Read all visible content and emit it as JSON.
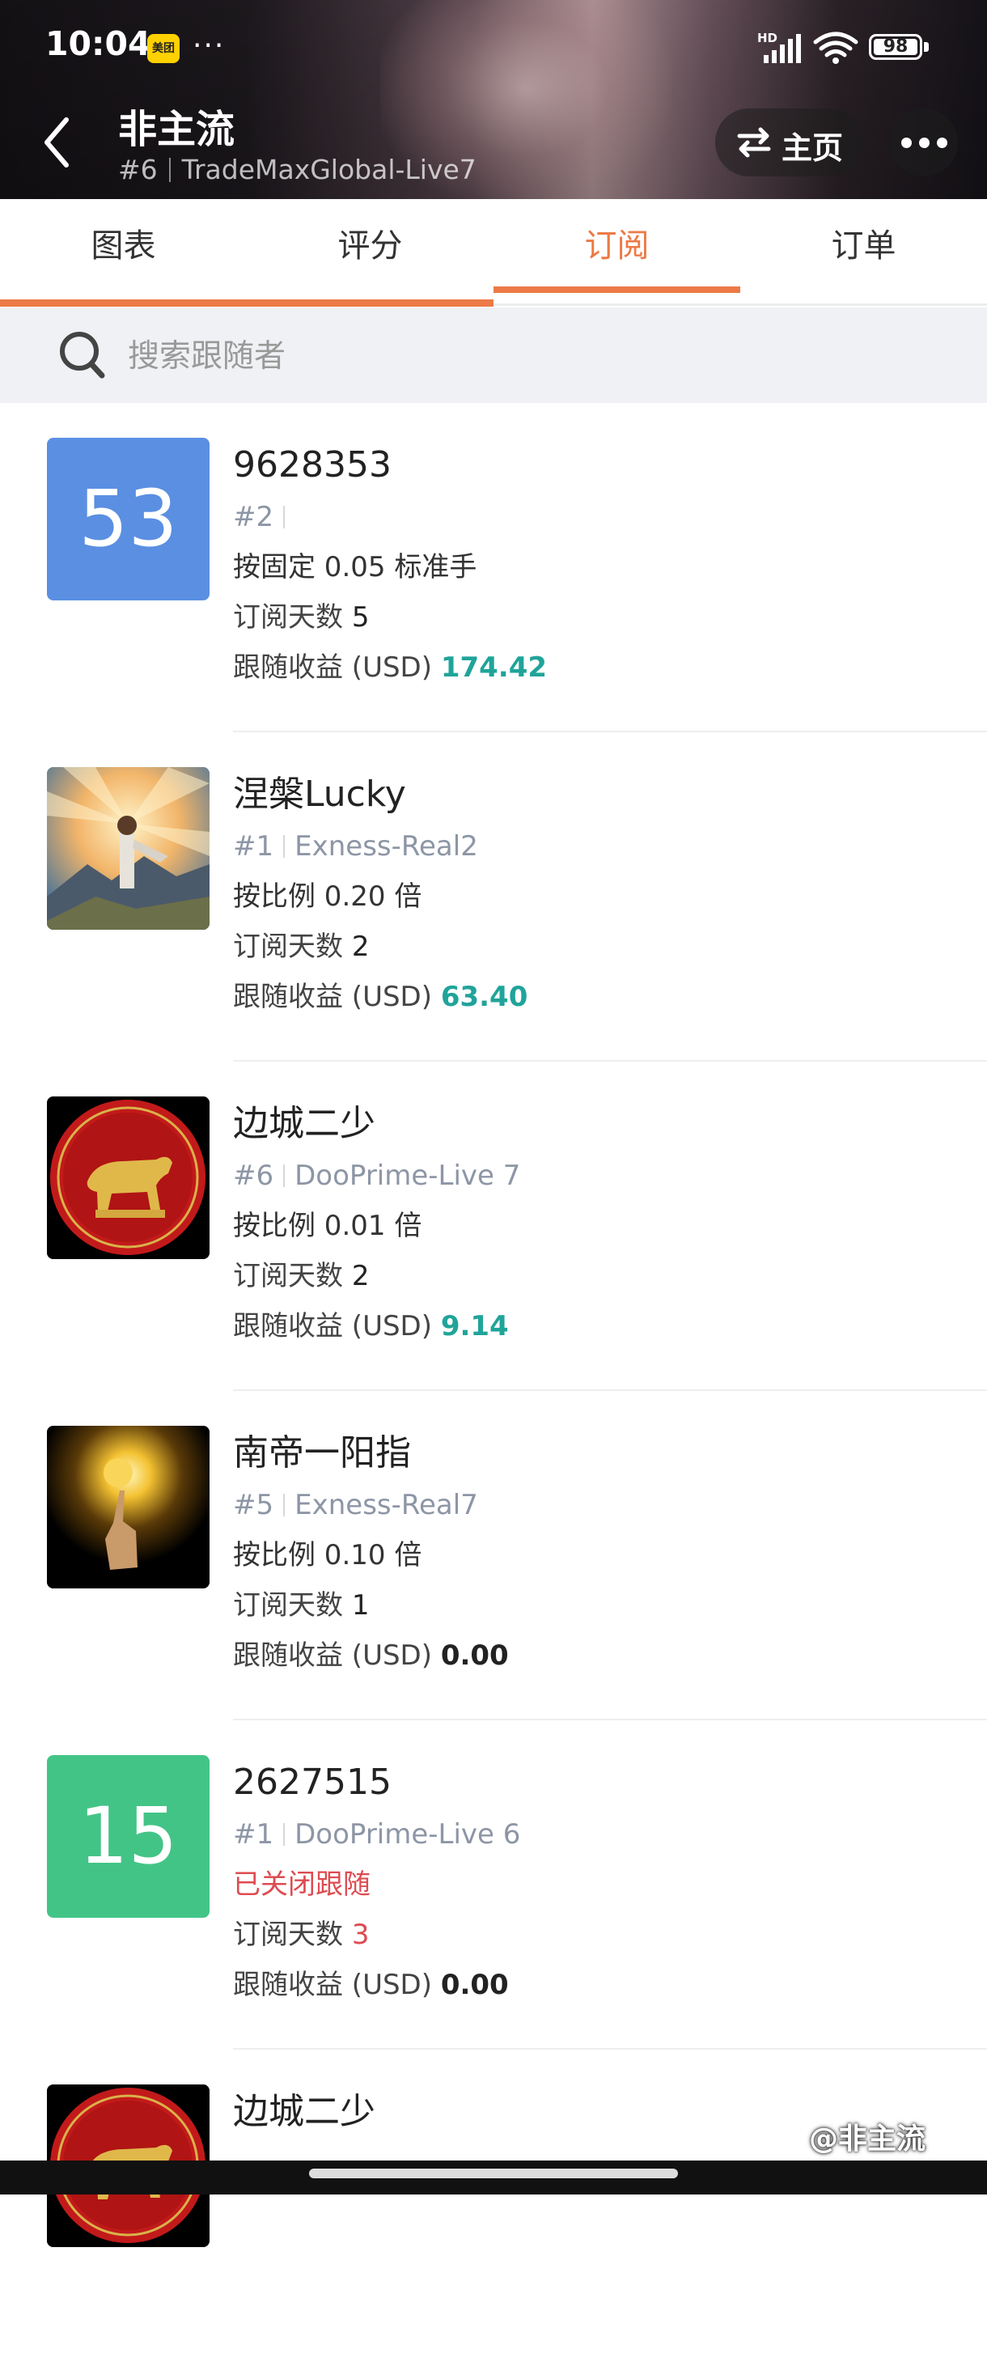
{
  "status_bar": {
    "time": "10:04",
    "app_badge": "美团",
    "more": "···",
    "network": "HD",
    "battery": "98"
  },
  "header": {
    "title": "非主流",
    "rank": "#6",
    "server": "TradeMaxGlobal-Live7",
    "home_label": "主页"
  },
  "tabs": [
    {
      "label": "图表",
      "active": false
    },
    {
      "label": "评分",
      "active": false
    },
    {
      "label": "订阅",
      "active": true
    },
    {
      "label": "订单",
      "active": false
    }
  ],
  "search": {
    "placeholder": "搜索跟随者"
  },
  "labels": {
    "days": "订阅天数",
    "profit": "跟随收益 (USD)"
  },
  "followers": [
    {
      "avatar_text": "53",
      "name": "9628353",
      "rank": "#2",
      "server": "",
      "mode": "按固定 0.05 标准手",
      "days": "5",
      "profit": "174.42"
    },
    {
      "avatar_text": "",
      "name": "涅槃Lucky",
      "rank": "#1",
      "server": "Exness-Real2",
      "mode": "按比例 0.20 倍",
      "days": "2",
      "profit": "63.40"
    },
    {
      "avatar_text": "",
      "name": "边城二少",
      "rank": "#6",
      "server": "DooPrime-Live 7",
      "mode": "按比例 0.01 倍",
      "days": "2",
      "profit": "9.14"
    },
    {
      "avatar_text": "",
      "name": "南帝一阳指",
      "rank": "#5",
      "server": "Exness-Real7",
      "mode": "按比例 0.10 倍",
      "days": "1",
      "profit": "0.00"
    },
    {
      "avatar_text": "15",
      "name": "2627515",
      "rank": "#1",
      "server": "DooPrime-Live 6",
      "mode": "已关闭跟随",
      "days": "3",
      "profit": "0.00"
    },
    {
      "name": "边城二少"
    }
  ],
  "watermark": "@非主流",
  "colors": {
    "accent": "#ec7a46",
    "profit_positive": "#20a49a",
    "closed_red": "#dd4b51",
    "avatar_blue": "#5a8fe2",
    "avatar_green": "#43c487"
  }
}
